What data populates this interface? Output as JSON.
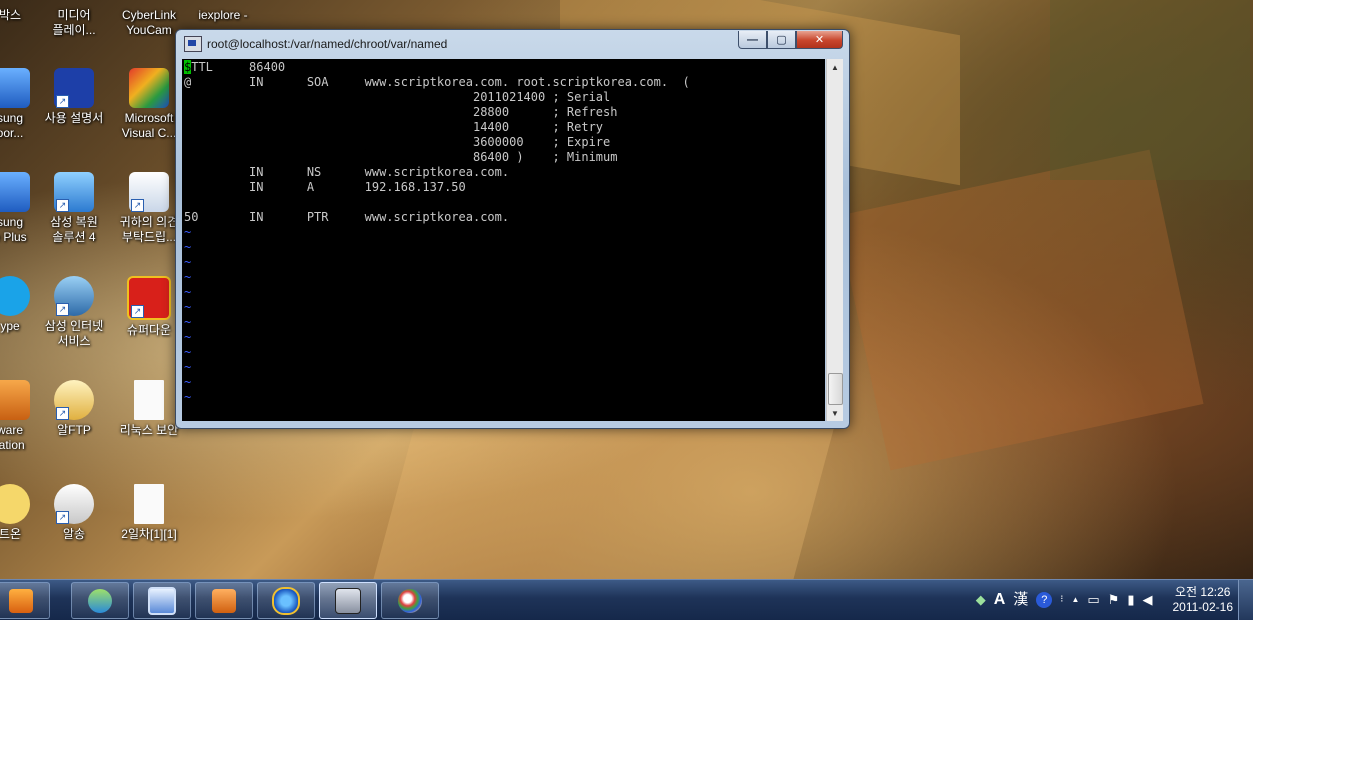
{
  "desktop": {
    "icons": [
      {
        "label1": "박스",
        "label2": ""
      },
      {
        "label1": "미디어",
        "label2": "플레이..."
      },
      {
        "label1": "CyberLink",
        "label2": "YouCam"
      },
      {
        "label1": "iexplore -",
        "label2": ""
      },
      {
        "label1": "sung",
        "label2": "oor..."
      },
      {
        "label1": "사용 설명서",
        "label2": ""
      },
      {
        "label1": "Microsoft",
        "label2": "Visual C..."
      },
      {
        "label1": "sung",
        "label2": "e Plus"
      },
      {
        "label1": "삼성 복원",
        "label2": "솔루션 4"
      },
      {
        "label1": "귀하의 의견",
        "label2": "부탁드립..."
      },
      {
        "label1": "ype",
        "label2": ""
      },
      {
        "label1": "삼성 인터넷",
        "label2": "서비스"
      },
      {
        "label1": "슈퍼다운",
        "label2": ""
      },
      {
        "label1": "ware",
        "label2": "tation"
      },
      {
        "label1": "알FTP",
        "label2": ""
      },
      {
        "label1": "리눅스 보안",
        "label2": ""
      },
      {
        "label1": "트온",
        "label2": ""
      },
      {
        "label1": "알송",
        "label2": ""
      },
      {
        "label1": "2일차[1][1]",
        "label2": ""
      }
    ]
  },
  "window": {
    "title": "root@localhost:/var/named/chroot/var/named",
    "minimize": "—",
    "maximize": "▢",
    "close": "✕"
  },
  "terminal": {
    "cursor_char": "$",
    "lines": [
      "TTL     86400",
      "@        IN      SOA     www.scriptkorea.com. root.scriptkorea.com.  (",
      "                                        2011021400 ; Serial",
      "                                        28800      ; Refresh",
      "                                        14400      ; Retry",
      "                                        3600000    ; Expire",
      "                                        86400 )    ; Minimum",
      "         IN      NS      www.scriptkorea.com.",
      "         IN      A       192.168.137.50",
      "",
      "50       IN      PTR     www.scriptkorea.com."
    ],
    "tilde": "~"
  },
  "tray": {
    "lang_a": "A",
    "lang_han": "漢",
    "help": "?",
    "caret": "▲",
    "volume": "◀",
    "time": "오전 12:26",
    "date": "2011-02-16"
  },
  "colors": {
    "taskbar": "#1e3358",
    "terminal_bg": "#000000",
    "cursor": "#00c000",
    "tilde": "#3a5cff"
  }
}
